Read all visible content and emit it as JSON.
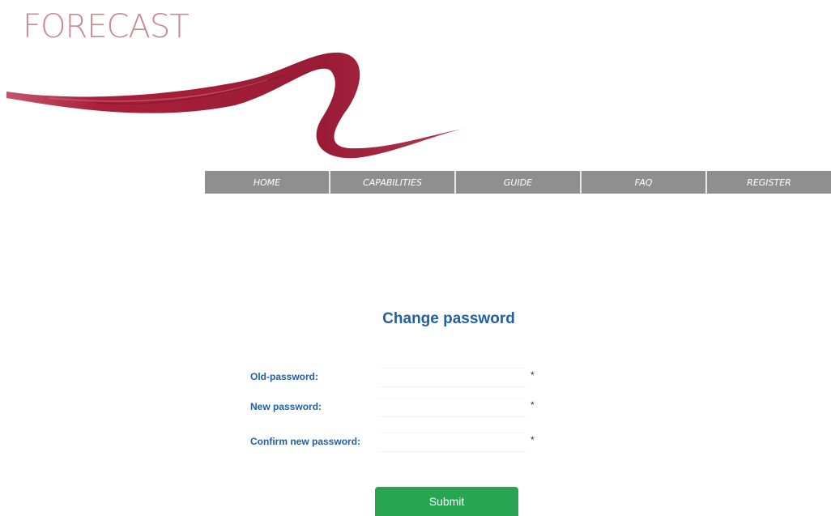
{
  "logo": {
    "text": "FORECAST",
    "stroke_color": "#a8203a"
  },
  "nav": {
    "items": [
      {
        "label": "HOME"
      },
      {
        "label": "CAPABILITIES"
      },
      {
        "label": "GUIDE"
      },
      {
        "label": "FAQ"
      },
      {
        "label": "REGISTER"
      }
    ]
  },
  "form": {
    "title": "Change password",
    "fields": [
      {
        "label": "Old-password:",
        "value": "",
        "required_mark": "*"
      },
      {
        "label": "New password:",
        "value": "",
        "required_mark": "*"
      },
      {
        "label": "Confirm new password:",
        "value": "",
        "required_mark": "*"
      }
    ],
    "submit_label": "Submit"
  },
  "colors": {
    "logo_text": "#c98a92",
    "nav_background": "#8f8f8f",
    "label_blue": "#1f5fa8",
    "submit_green": "#27a552"
  }
}
